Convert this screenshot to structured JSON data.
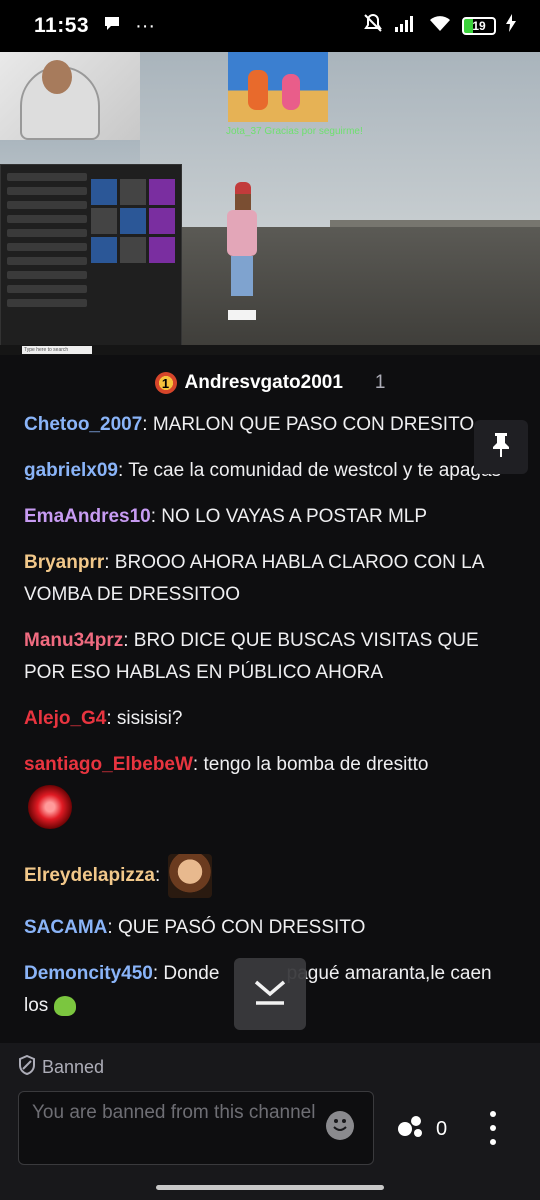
{
  "status_bar": {
    "time": "11:53",
    "more": "···",
    "battery": "19"
  },
  "video": {
    "donation_text": "Jota_37 Gracias por seguirme!",
    "taskbar_search_placeholder": "Type here to search"
  },
  "stream": {
    "streamer_name": "Andresvgato2001",
    "viewer_count": "1"
  },
  "chat": {
    "messages": [
      {
        "user": "Chetoo_2007",
        "color": "#8ab4f8",
        "text": ": MARLON QUE PASO CON DRESITO"
      },
      {
        "user": "gabrielx09",
        "color": "#8ab4f8",
        "text": ": Te cae la comunidad de westcol y te apagas"
      },
      {
        "user": "EmaAndres10",
        "color": "#c79bf2",
        "text": ": NO LO VAYAS A POSTAR MLP"
      },
      {
        "user": "Bryanprr",
        "color": "#f2c88a",
        "text": ": BROOO AHORA HABLA CLAROO CON LA VOMBA DE DRESSITOO"
      },
      {
        "user": "Manu34prz",
        "color": "#f06b80",
        "text": ": BRO DICE QUE BUSCAS VISITAS QUE POR ESO HABLAS EN PÚBLICO AHORA"
      },
      {
        "user": "Alejo_G4",
        "color": "#e8343f",
        "text": ": sisisisi?"
      },
      {
        "user": "santiago_ElbebeW",
        "color": "#e8343f",
        "text": ": tengo la bomba de dresitto"
      },
      {
        "user": "Elreydelapizza",
        "color": "#f2c88a",
        "text": ":"
      },
      {
        "user": "SACAMA",
        "color": "#8ab4f8",
        "text": ": QUE PASÓ CON DRESSITO"
      },
      {
        "user": "Demoncity450",
        "color": "#8ab4f8",
        "text": ": Donde ",
        "text_after": "pagué amaranta,le caen los"
      }
    ]
  },
  "footer": {
    "banned_label": "Banned",
    "input_placeholder": "You are banned from this channel",
    "points_count": "0"
  },
  "icons": {
    "pin": "pin-icon",
    "jump": "chevron-down-icon",
    "emoji": "emoji-icon",
    "points": "channel-points-icon",
    "more": "kebab-menu-icon"
  }
}
